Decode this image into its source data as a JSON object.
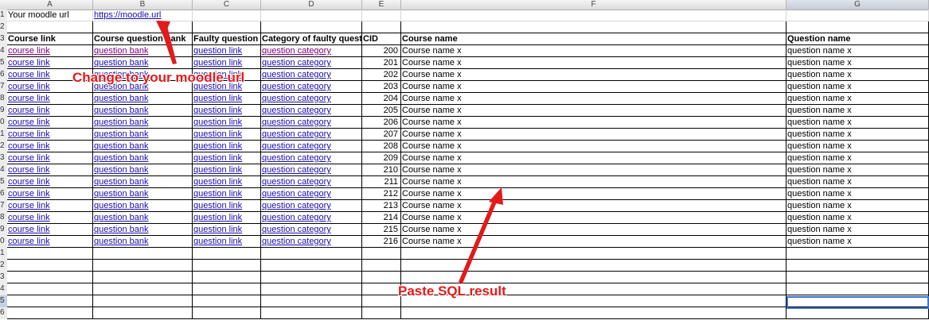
{
  "columns": [
    "A",
    "B",
    "C",
    "D",
    "E",
    "F",
    "G"
  ],
  "row_numbers": [
    "1",
    "2",
    "3",
    "4",
    "5",
    "6",
    "7",
    "8",
    "9",
    "0",
    "1",
    "2",
    "3",
    "4",
    "5",
    "6",
    "7",
    "8",
    "9",
    "0",
    "1",
    "2",
    "3",
    "4",
    "5",
    "6"
  ],
  "row1": {
    "label": "Your moodle url",
    "url": "https://moodle.url"
  },
  "headers": [
    "Course link",
    "Course question bank",
    "Faulty question",
    "Category of faulty question",
    "CID",
    "Course name",
    "Question name"
  ],
  "link_texts": {
    "course": "course link",
    "bank": "question bank",
    "question": "question link",
    "category": "question category"
  },
  "rows": [
    {
      "cid": "200",
      "course": "Course name x",
      "question": "question name x"
    },
    {
      "cid": "201",
      "course": "Course name x",
      "question": "question name x"
    },
    {
      "cid": "202",
      "course": "Course name x",
      "question": "question name x"
    },
    {
      "cid": "203",
      "course": "Course name x",
      "question": "question name x"
    },
    {
      "cid": "204",
      "course": "Course name x",
      "question": "question name x"
    },
    {
      "cid": "205",
      "course": "Course name x",
      "question": "question name x"
    },
    {
      "cid": "206",
      "course": "Course name x",
      "question": "question name x"
    },
    {
      "cid": "207",
      "course": "Course name x",
      "question": "question name x"
    },
    {
      "cid": "208",
      "course": "Course name x",
      "question": "question name x"
    },
    {
      "cid": "209",
      "course": "Course name x",
      "question": "question name x"
    },
    {
      "cid": "210",
      "course": "Course name x",
      "question": "question name x"
    },
    {
      "cid": "211",
      "course": "Course name x",
      "question": "question name x"
    },
    {
      "cid": "212",
      "course": "Course name x",
      "question": "question name x"
    },
    {
      "cid": "213",
      "course": "Course name x",
      "question": "question name x"
    },
    {
      "cid": "214",
      "course": "Course name x",
      "question": "question name x"
    },
    {
      "cid": "215",
      "course": "Course name x",
      "question": "question name x"
    },
    {
      "cid": "216",
      "course": "Course name x",
      "question": "question name x"
    }
  ],
  "annotations": {
    "change_url": "Change to your moodle url",
    "paste_sql": "Paste SQL result"
  },
  "colors": {
    "annotation": "#e21a1a",
    "link": "#1a0dab",
    "visited": "#800080",
    "selection": "#3b73d1"
  }
}
